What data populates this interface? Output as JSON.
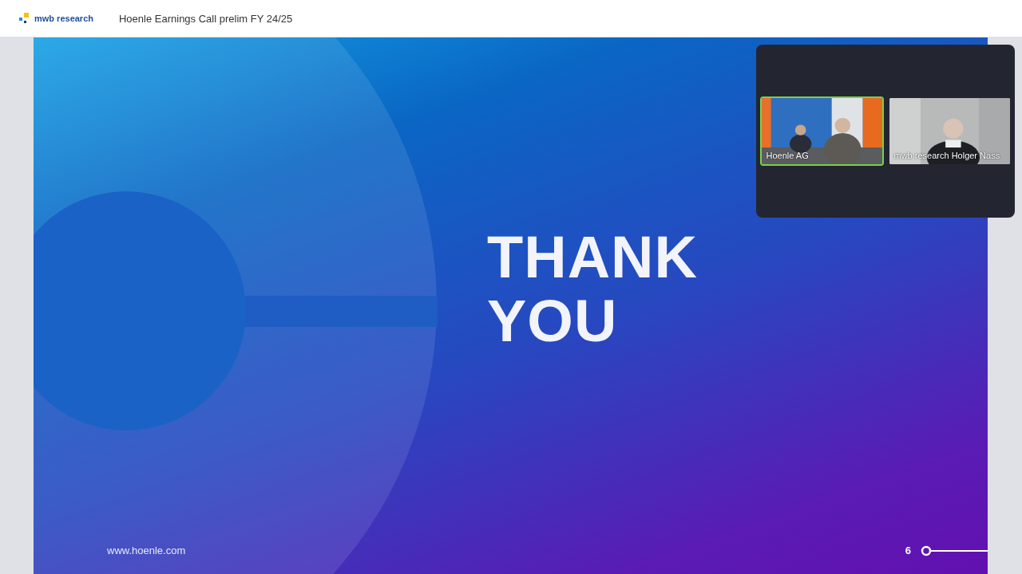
{
  "header": {
    "brand": "mwb research",
    "title": "Hoenle Earnings Call prelim FY 24/25"
  },
  "slide": {
    "heading_lines": [
      "THANK",
      "YOU"
    ],
    "website": "www.hoenle.com",
    "page_number": "6"
  },
  "participants": [
    {
      "name": "Hoenle AG",
      "speaking": true
    },
    {
      "name": "mwb research Holger Nass",
      "speaking": false
    }
  ]
}
